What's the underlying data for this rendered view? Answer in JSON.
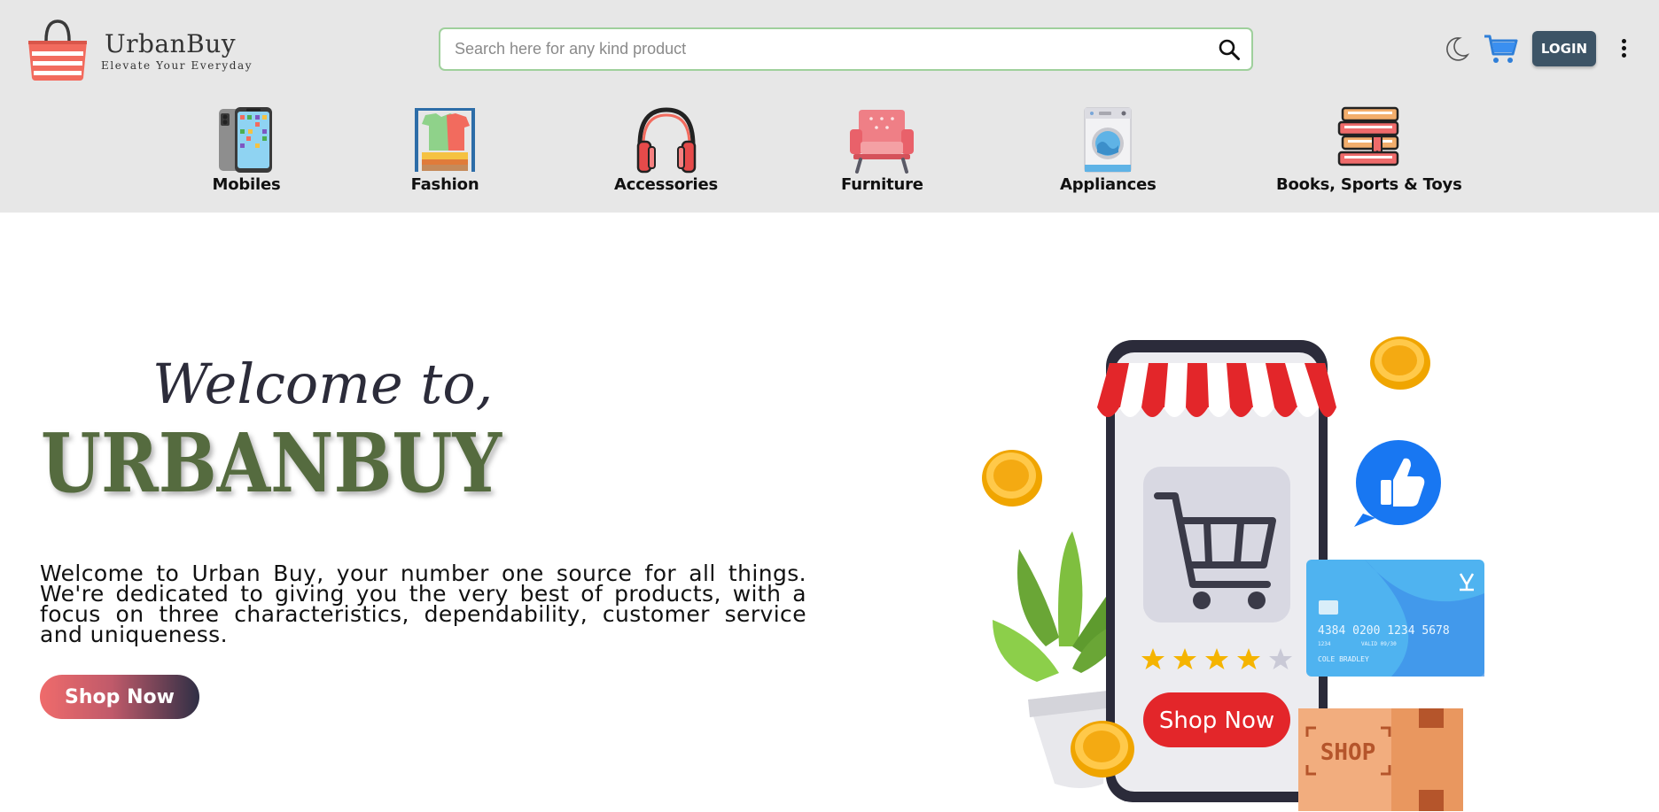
{
  "brand": {
    "name": "UrbanBuy",
    "tagline": "Elevate Your Everyday"
  },
  "search": {
    "placeholder": "Search here for any kind product",
    "value": ""
  },
  "header_actions": {
    "theme_icon": "moon-icon",
    "cart_icon": "cart-icon",
    "login_label": "LOGIN",
    "menu_icon": "kebab-menu-icon"
  },
  "categories": [
    {
      "label": "Mobiles",
      "icon": "mobile-phone-icon"
    },
    {
      "label": "Fashion",
      "icon": "clothes-rack-icon"
    },
    {
      "label": "Accessories",
      "icon": "headphones-icon"
    },
    {
      "label": "Furniture",
      "icon": "armchair-icon"
    },
    {
      "label": "Appliances",
      "icon": "washing-machine-icon"
    },
    {
      "label": "Books, Sports & Toys",
      "icon": "books-icon"
    }
  ],
  "hero": {
    "heading_line1": "Welcome to,",
    "heading_line2": "URBANBUY",
    "description": "Welcome to Urban Buy, your number one source for all things. We're dedicated to giving you the very best of products, with a focus on three characteristics, dependability, customer service and uniqueness.",
    "cta_label": "Shop Now",
    "illustration": {
      "button_label": "Shop Now",
      "box_label": "SHOP",
      "card_number": "4384 0200 1234 5678",
      "card_small": "1234",
      "card_valid": "VALID 09/30",
      "card_name": "COLE BRADLEY",
      "rating": 4,
      "rating_max": 5
    }
  },
  "colors": {
    "header_bg": "#e7e7e7",
    "login_bg": "#3d5466",
    "search_border": "#9fd09c",
    "brand_green": "#556b3f",
    "accent_red": "#e3262a"
  }
}
